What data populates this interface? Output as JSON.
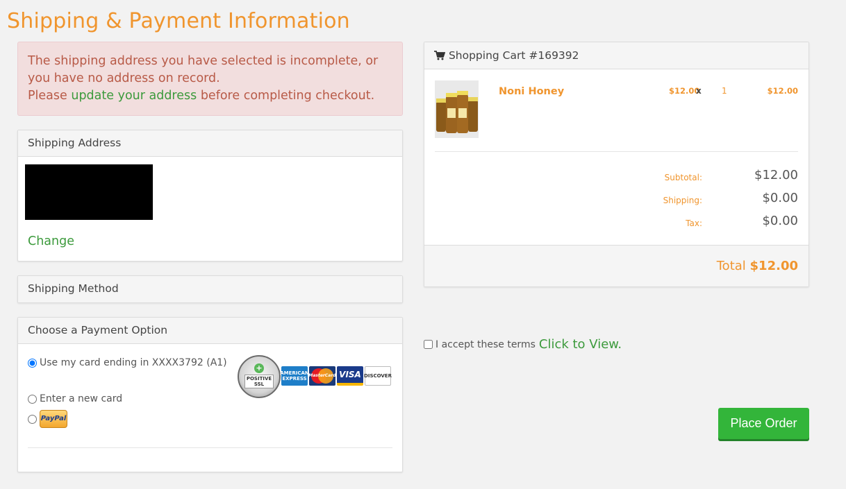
{
  "page": {
    "title": "Shipping & Payment Information"
  },
  "alert": {
    "message": "The shipping address you have selected is incomplete, or you have no address on record.",
    "prefix": "Please ",
    "link_text": "update your address",
    "suffix": " before completing checkout."
  },
  "shipping_address": {
    "heading": "Shipping Address",
    "change_label": "Change"
  },
  "shipping_method": {
    "heading": "Shipping Method"
  },
  "payment": {
    "heading": "Choose a Payment Option",
    "options": [
      {
        "label": "Use my card ending in XXXX3792 (A1)",
        "selected": true
      },
      {
        "label": "Enter a new card",
        "selected": false
      },
      {
        "label": "PayPal",
        "selected": false
      }
    ],
    "ssl_seal": "POSITIVE SSL",
    "cards": [
      "AMERICAN EXPRESS",
      "MasterCard",
      "VISA",
      "DISCOVER"
    ]
  },
  "cart": {
    "heading": "Shopping Cart #169392",
    "items": [
      {
        "name": "Noni Honey",
        "unit_price": "$12.00",
        "times": "x",
        "qty": "1",
        "line_total": "$12.00"
      }
    ],
    "summary": {
      "subtotal_label": "Subtotal:",
      "subtotal": "$12.00",
      "shipping_label": "Shipping:",
      "shipping": "$0.00",
      "tax_label": "Tax:",
      "tax": "$0.00",
      "total_label": "Total",
      "total": "$12.00"
    }
  },
  "terms": {
    "label": "I accept these terms",
    "link": "Click to View."
  },
  "actions": {
    "place_order": "Place Order"
  },
  "colors": {
    "accent": "#f0952e",
    "link_green": "#3c9a3c",
    "button_green": "#33b53a",
    "alert_bg": "#f2dede"
  }
}
